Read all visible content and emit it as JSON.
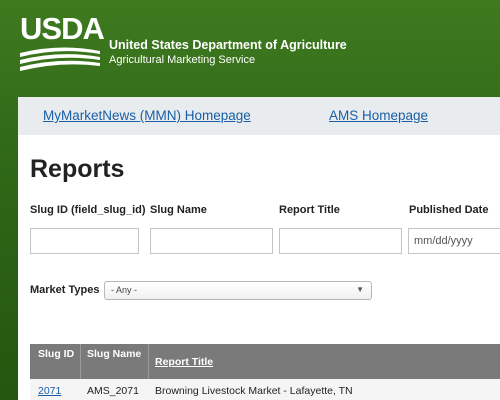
{
  "header": {
    "logo_text": "USDA",
    "department": "United States Department of Agriculture",
    "service": "Agricultural Marketing Service"
  },
  "nav": {
    "mmn_link": "MyMarketNews (MMN) Homepage",
    "ams_link": "AMS Homepage"
  },
  "page": {
    "title": "Reports"
  },
  "filters": {
    "slug_id_label": "Slug ID (field_slug_id)",
    "slug_name_label": "Slug Name",
    "report_title_label": "Report Title",
    "published_date_label": "Published Date",
    "slug_id_value": "",
    "slug_name_value": "",
    "report_title_value": "",
    "published_date_placeholder": "mm/dd/yyyy",
    "market_types_label": "Market Types",
    "market_types_selected": "- Any -"
  },
  "table": {
    "headers": {
      "slug_id": "Slug ID",
      "slug_name": "Slug Name",
      "report_title": "Report Title"
    },
    "rows": [
      {
        "slug_id": "2071",
        "slug_name": "AMS_2071",
        "report_title": "Browning Livestock Market - Lafayette, TN"
      }
    ]
  },
  "colors": {
    "header_green": "#2f6817",
    "link_blue": "#1a5ea6",
    "table_header": "#7a7a7a"
  }
}
